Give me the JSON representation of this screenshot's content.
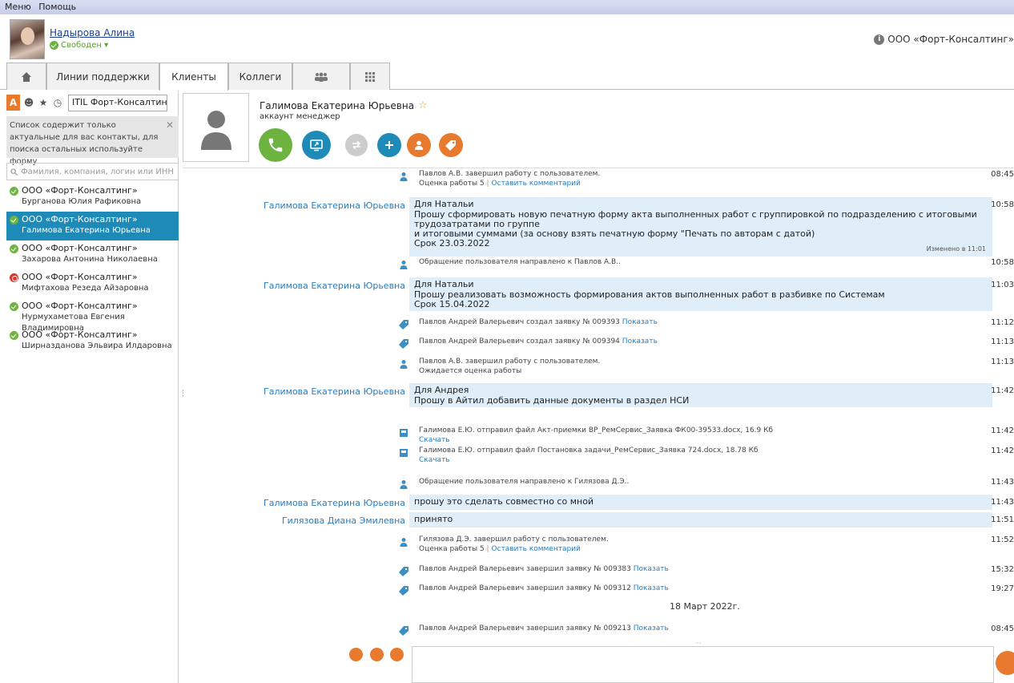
{
  "menu": {
    "items": [
      "Меню",
      "Помощь"
    ]
  },
  "user": {
    "name": "Надырова Алина",
    "status": "Свободен ▾"
  },
  "company": "ООО «Форт-Консалтинг»",
  "tabs": [
    "Линии поддержки",
    "Клиенты",
    "Коллеги"
  ],
  "sidebar": {
    "filter_letter": "A",
    "select_value": "ITIL Форт-Консалтинг",
    "note": "Список содержит только актуальные для вас контакты, для поиска остальных используйте форму",
    "search_placeholder": "Фамилия, компания, логин или ИНН",
    "contacts": [
      {
        "company": "ООО «Форт-Консалтинг»",
        "name": "Бурганова Юлия Рафиковна",
        "status": "online"
      },
      {
        "company": "ООО «Форт-Консалтинг»",
        "name": "Галимова Екатерина Юрьевна",
        "status": "online",
        "selected": true
      },
      {
        "company": "ООО «Форт-Консалтинг»",
        "name": "Захарова Антонина Николаевна",
        "status": "online"
      },
      {
        "company": "ООО «Форт-Консалтинг»",
        "name": "Мифтахова Резеда Айзаровна",
        "status": "busy"
      },
      {
        "company": "ООО «Форт-Консалтинг»",
        "name": "Нурмухаметова Евгения Владимировна",
        "status": "online"
      },
      {
        "company": "ООО «Форт-Консалтинг»",
        "name": "Ширназданова Эльвира Илдаровна",
        "status": "online"
      }
    ]
  },
  "contact": {
    "name": "Галимова Екатерина Юрьевна",
    "role": "аккаунт менеджер"
  },
  "colors": {
    "accent": "#1e8ab8",
    "call": "#6cb33f",
    "orange": "#e77a2e",
    "message_bg": "#dfeef8"
  },
  "feed": [
    {
      "kind": "event",
      "icon": "person",
      "text": "Павлов А.В. завершил работу с пользователем.",
      "line2": "Оценка работы 5",
      "link": "Оставить комментарий",
      "time": "08:45"
    },
    {
      "kind": "message",
      "from": "Галимова Екатерина Юрьевна",
      "lines": [
        "Для Натальи",
        "Прошу сформировать новую печатную форму акта выполненных работ с группировкой по подразделению с итоговыми трудозатратами по группе",
        "и итоговыми суммами (за основу взять печатную форму \"Печать по авторам с датой)",
        "Срок 23.03.2022"
      ],
      "edited": "Изменено в 11:01",
      "time": "10:58"
    },
    {
      "kind": "event",
      "icon": "person",
      "text": "Обращение пользователя направлено к Павлов А.В..",
      "time": "10:58"
    },
    {
      "kind": "message",
      "from": "Галимова Екатерина Юрьевна",
      "lines": [
        "Для Натальи",
        "Прошу реализовать возможность формирования актов выполненных работ в разбивке по Системам",
        "Срок 15.04.2022"
      ],
      "time": "11:03"
    },
    {
      "kind": "event",
      "icon": "tag",
      "text": "Павлов Андрей Валерьевич создал заявку № 009393",
      "link": "Показать",
      "time": "11:12"
    },
    {
      "kind": "event",
      "icon": "tag",
      "text": "Павлов Андрей Валерьевич создал заявку № 009394",
      "link": "Показать",
      "time": "11:13"
    },
    {
      "kind": "event",
      "icon": "person",
      "text": "Павлов А.В. завершил работу с пользователем.",
      "line2": "Ожидается оценка работы",
      "time": "11:13"
    },
    {
      "kind": "message",
      "from": "Галимова Екатерина Юрьевна",
      "lines": [
        "Для Андрея",
        "Прошу в Айтил добавить данные документы в раздел НСИ"
      ],
      "time": "11:42"
    },
    {
      "kind": "event",
      "icon": "file",
      "text": "Галимова Е.Ю. отправил файл Акт-приемки ВР_РемСервис_Заявка ФК00-39533.docx, 16.9 Кб",
      "line2link": "Скачать",
      "time": "11:42"
    },
    {
      "kind": "event",
      "icon": "file",
      "text": "Галимова Е.Ю. отправил файл Постановка задачи_РемСервис_Заявка 724.docx, 18.78 Кб",
      "line2link": "Скачать",
      "time": "11:42"
    },
    {
      "kind": "event",
      "icon": "person",
      "text": "Обращение пользователя направлено к Гилязова Д.Э..",
      "time": "11:43"
    },
    {
      "kind": "message",
      "from": "Галимова Екатерина Юрьевна",
      "lines": [
        "прошу это сделать совместно со мной"
      ],
      "time": "11:43"
    },
    {
      "kind": "message",
      "from": "Гилязова Диана Эмилевна",
      "lines": [
        "принято"
      ],
      "time": "11:51"
    },
    {
      "kind": "event",
      "icon": "person",
      "text": "Гилязова Д.Э. завершил работу с пользователем.",
      "line2": "Оценка работы 5",
      "link": "Оставить комментарий",
      "time": "11:52"
    },
    {
      "kind": "event",
      "icon": "tag",
      "text": "Павлов Андрей Валерьевич завершил заявку № 009383",
      "link": "Показать",
      "time": "15:32"
    },
    {
      "kind": "event",
      "icon": "tag",
      "text": "Павлов Андрей Валерьевич завершил заявку № 009312",
      "link": "Показать",
      "time": "19:27"
    },
    {
      "kind": "date",
      "text": "18 Март 2022г."
    },
    {
      "kind": "event",
      "icon": "tag",
      "text": "Павлов Андрей Валерьевич завершил заявку № 009213",
      "link": "Показать",
      "time": "08:45"
    }
  ]
}
